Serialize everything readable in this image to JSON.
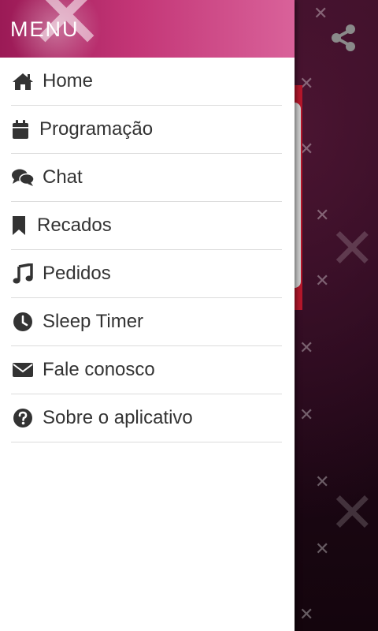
{
  "drawer": {
    "title": "MENU",
    "items": [
      {
        "label": "Home",
        "icon": "home-icon"
      },
      {
        "label": "Programação",
        "icon": "calendar-icon"
      },
      {
        "label": "Chat",
        "icon": "chat-icon"
      },
      {
        "label": "Recados",
        "icon": "bookmark-icon"
      },
      {
        "label": "Pedidos",
        "icon": "music-icon"
      },
      {
        "label": "Sleep Timer",
        "icon": "clock-icon"
      },
      {
        "label": "Fale conosco",
        "icon": "envelope-icon"
      },
      {
        "label": "Sobre o aplicativo",
        "icon": "question-circle-icon"
      }
    ]
  },
  "app": {
    "share_icon": "share-icon"
  },
  "colors": {
    "header_pink": "#c33576",
    "background_dark": "#1a0712",
    "text": "#333333",
    "accent_red": "#b5172b"
  }
}
